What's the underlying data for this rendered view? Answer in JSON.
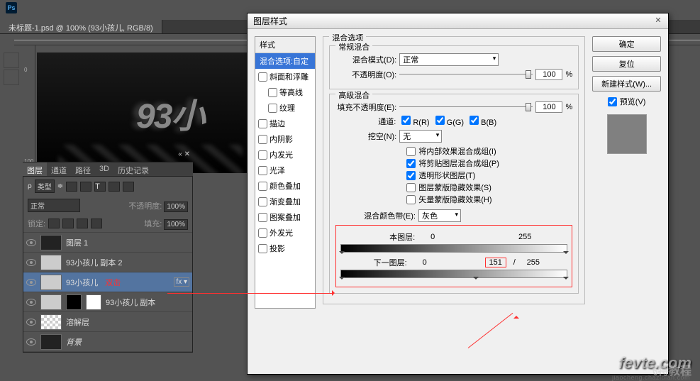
{
  "app": {
    "logo": "Ps"
  },
  "document": {
    "tab_title": "未标题-1.psd @ 100% (93小孩儿, RGB/8)",
    "canvas_text": "93小"
  },
  "ruler": {
    "tick_0": "0",
    "tick_100": "100"
  },
  "layers_panel": {
    "tabs": [
      "图层",
      "通道",
      "路径",
      "3D",
      "历史记录"
    ],
    "kind_label": "类型",
    "blend_mode": "正常",
    "opacity_label": "不透明度:",
    "opacity_value": "100%",
    "lock_label": "锁定:",
    "fill_label": "填充:",
    "fill_value": "100%",
    "layers": [
      {
        "name": "图层 1"
      },
      {
        "name": "93小孩儿 副本 2"
      },
      {
        "name": "93小孩儿",
        "annotation": "双击",
        "fx": "fx ▾"
      },
      {
        "name": "93小孩儿 副本"
      },
      {
        "name": "溶解层"
      },
      {
        "name": "背景"
      }
    ]
  },
  "dialog": {
    "title": "图层样式",
    "styles_header": "样式",
    "blend_options_row": "混合选项:自定",
    "style_items": [
      "斜面和浮雕",
      "等高线",
      "纹理",
      "描边",
      "内阴影",
      "内发光",
      "光泽",
      "颜色叠加",
      "渐变叠加",
      "图案叠加",
      "外发光",
      "投影"
    ],
    "blend_options_legend": "混合选项",
    "general_legend": "常规混合",
    "blend_mode_label": "混合模式(D):",
    "blend_mode_value": "正常",
    "opacity_label": "不透明度(O):",
    "opacity_value": "100",
    "percent": "%",
    "advanced_legend": "高级混合",
    "fill_opacity_label": "填充不透明度(E):",
    "fill_opacity_value": "100",
    "channels_label": "通道:",
    "ch_r": "R(R)",
    "ch_g": "G(G)",
    "ch_b": "B(B)",
    "knockout_label": "挖空(N):",
    "knockout_value": "无",
    "adv_checks": [
      "将内部效果混合成组(I)",
      "将剪贴图层混合成组(P)",
      "透明形状图层(T)",
      "图层蒙版隐藏效果(S)",
      "矢量蒙版隐藏效果(H)"
    ],
    "adv_checked": [
      false,
      true,
      true,
      false,
      false
    ],
    "blend_if_label": "混合颜色带(E):",
    "blend_if_value": "灰色",
    "this_layer_label": "本图层:",
    "this_black": "0",
    "this_white": "255",
    "under_layer_label": "下一图层:",
    "under_black": "0",
    "under_white_split": "151",
    "under_slash": "/",
    "under_white": "255",
    "buttons": {
      "ok": "确定",
      "cancel": "复位",
      "new_style": "新建样式(W)..."
    },
    "preview_label": "预览(V)"
  },
  "watermark": {
    "main": "fevte.com",
    "sub": "飞特教程",
    "tiny": "jiaocheng.chazidian.com"
  }
}
